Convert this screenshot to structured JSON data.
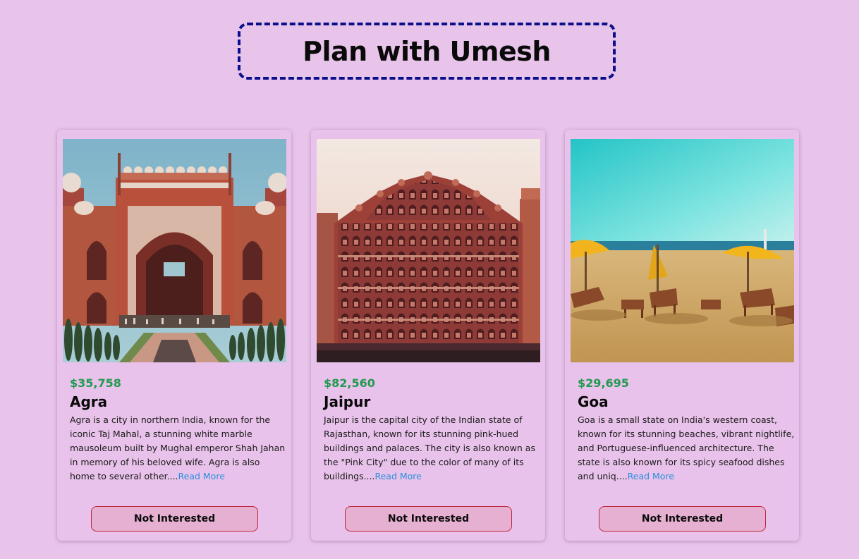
{
  "header": {
    "title": "Plan with Umesh"
  },
  "cards": [
    {
      "price": "$35,758",
      "name": "Agra",
      "description": "Agra is a city in northern India, known for the iconic Taj Mahal, a stunning white marble mausoleum built by Mughal emperor Shah Jahan in memory of his beloved wife. Agra is also home to several other....",
      "read_more": "Read More",
      "button": "Not Interested",
      "image": "taj-mahal-gate-photo"
    },
    {
      "price": "$82,560",
      "name": "Jaipur",
      "description": "Jaipur is the capital city of the Indian state of Rajasthan, known for its stunning pink-hued buildings and palaces. The city is also known as the \"Pink City\" due to the color of many of its buildings....",
      "read_more": "Read More",
      "button": "Not Interested",
      "image": "hawa-mahal-photo"
    },
    {
      "price": "$29,695",
      "name": "Goa",
      "description": "Goa is a small state on India's western coast, known for its stunning beaches, vibrant nightlife, and Portuguese-influenced architecture. The state is also known for its spicy seafood dishes and uniq....",
      "read_more": "Read More",
      "button": "Not Interested",
      "image": "goa-beach-photo"
    }
  ],
  "colors": {
    "background": "#e8c4ea",
    "title_border": "#0a0f8c",
    "price": "#1f9a4e",
    "link": "#2a8fe0",
    "button_border": "#c0253a",
    "button_bg": "#e5b0d2"
  }
}
